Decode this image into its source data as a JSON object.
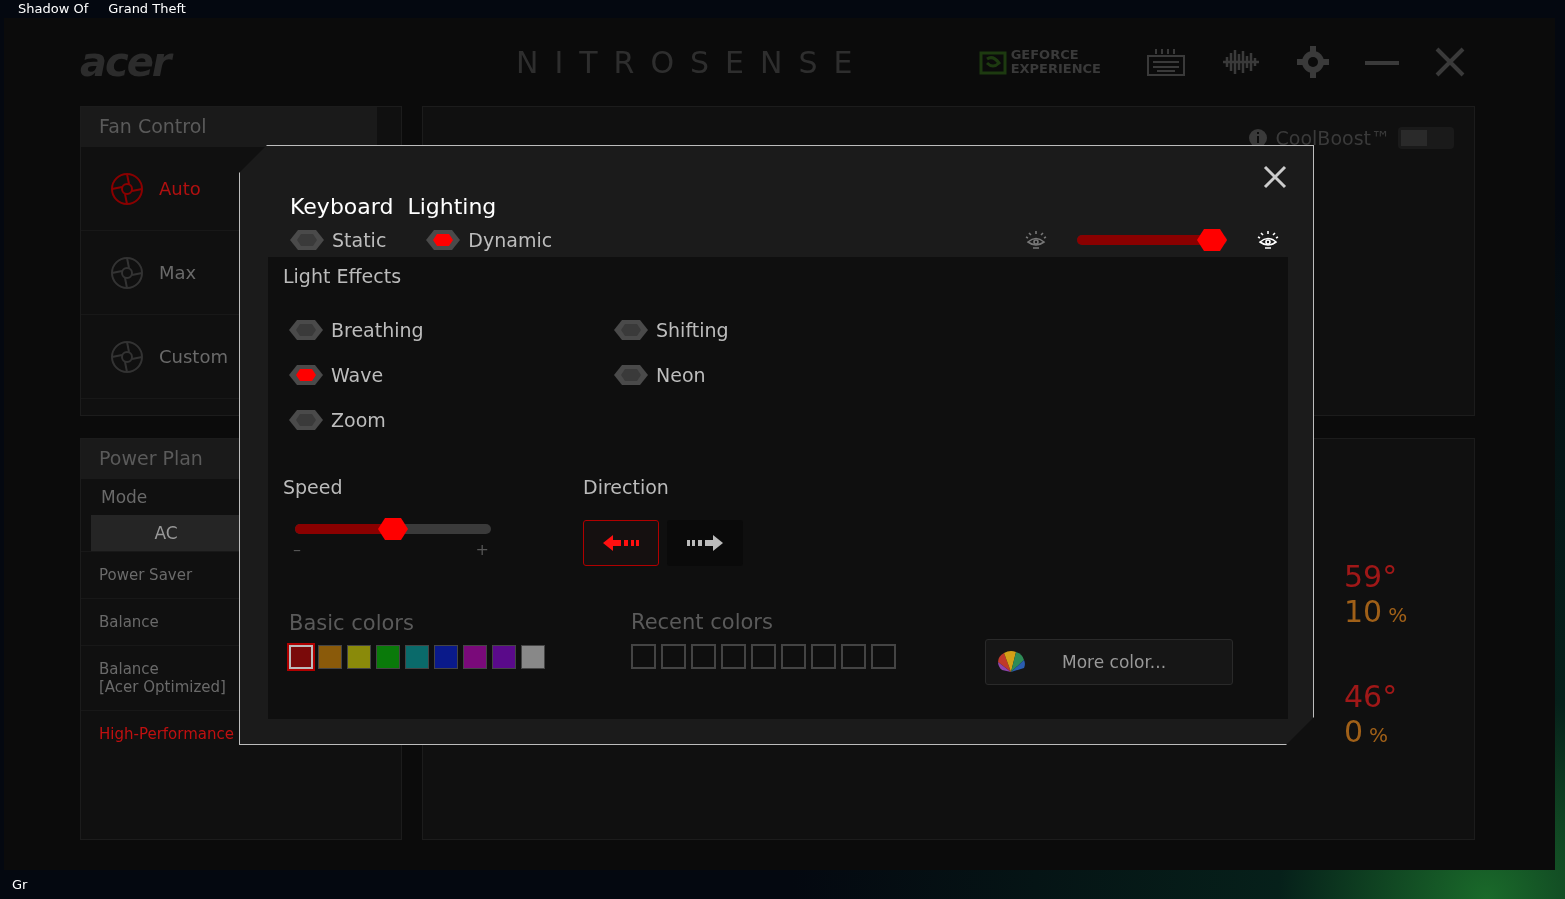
{
  "desktop": {
    "icon_labels": [
      "Shadow Of",
      "Grand Theft"
    ],
    "bottom_label": "Gr"
  },
  "app": {
    "logo": "acer",
    "title": "NITROSENSE",
    "geforce": [
      "GEFORCE",
      "EXPERIENCE"
    ],
    "fan_control": {
      "title": "Fan Control",
      "modes": [
        {
          "label": "Auto",
          "selected": true
        },
        {
          "label": "Max",
          "selected": false
        },
        {
          "label": "Custom",
          "selected": false
        }
      ]
    },
    "coolboost": {
      "label": "CoolBoost™",
      "on": false
    },
    "power_plan": {
      "title": "Power Plan",
      "mode_label": "Mode",
      "tabs": [
        {
          "label": "AC",
          "selected": true
        }
      ],
      "plans": [
        {
          "label": "Power Saver",
          "selected": false
        },
        {
          "label": "Balance",
          "selected": false
        },
        {
          "label": "Balance\n[Acer Optimized]",
          "selected": false
        },
        {
          "label": "High-Performance",
          "selected": true
        }
      ]
    },
    "monitors": [
      {
        "temperature": "59°",
        "fan": "10",
        "unit": "%"
      },
      {
        "temperature": "46°",
        "fan": "0",
        "unit": "%"
      }
    ]
  },
  "dialog": {
    "title": "Keyboard  Lighting",
    "modes": [
      {
        "label": "Static",
        "selected": false
      },
      {
        "label": "Dynamic",
        "selected": true
      }
    ],
    "brightness": {
      "level": 0.9
    },
    "effects_title": "Light Effects",
    "effects": [
      {
        "label": "Breathing",
        "selected": false
      },
      {
        "label": "Shifting",
        "selected": false
      },
      {
        "label": "Wave",
        "selected": true
      },
      {
        "label": "Neon",
        "selected": false
      },
      {
        "label": "Zoom",
        "selected": false
      }
    ],
    "speed": {
      "label": "Speed",
      "level": 0.5,
      "min": "–",
      "max": "+"
    },
    "direction": {
      "label": "Direction",
      "options": [
        {
          "kind": "left",
          "selected": true
        },
        {
          "kind": "right",
          "selected": false
        }
      ]
    },
    "basic_colors": {
      "label": "Basic colors",
      "swatches": [
        {
          "color": "#7a0a0a",
          "selected": true
        },
        {
          "color": "#8a5a0a",
          "selected": false
        },
        {
          "color": "#8a8a0a",
          "selected": false
        },
        {
          "color": "#0a7a0a",
          "selected": false
        },
        {
          "color": "#0a6a6a",
          "selected": false
        },
        {
          "color": "#0a1a8a",
          "selected": false
        },
        {
          "color": "#7a0a7a",
          "selected": false
        },
        {
          "color": "#5a0a8a",
          "selected": false
        },
        {
          "color": "#888888",
          "selected": false
        }
      ]
    },
    "recent_colors": {
      "label": "Recent colors"
    },
    "more_color": "More color..."
  }
}
